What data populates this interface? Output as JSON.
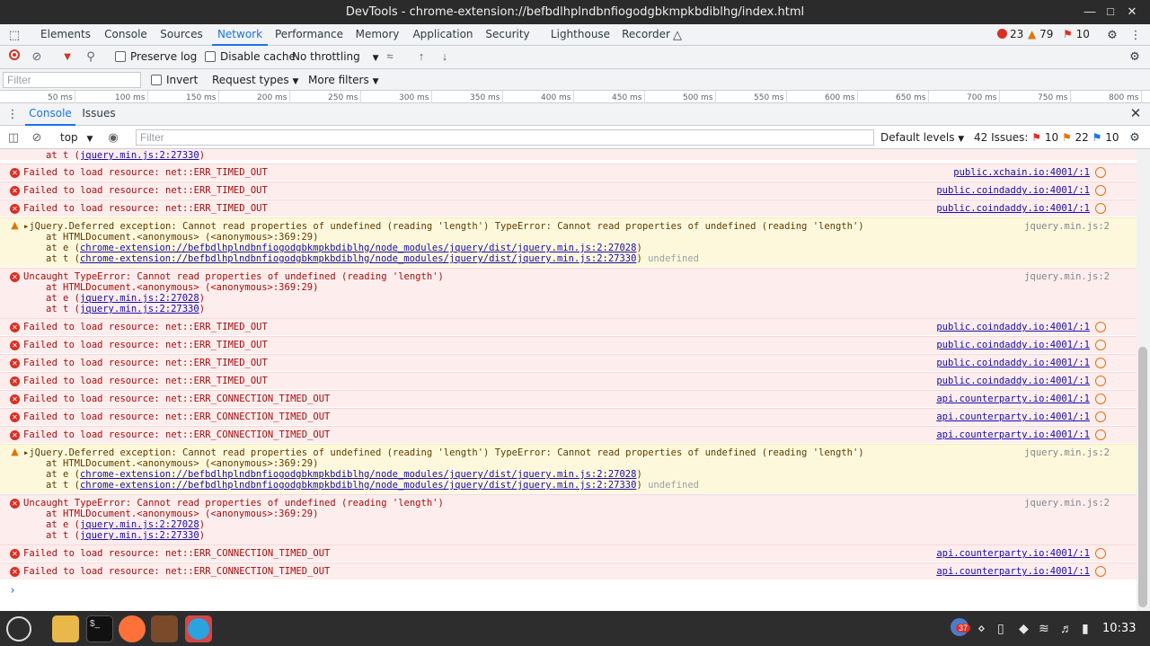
{
  "window": {
    "title": "DevTools - chrome-extension://befbdlhplndbnfiogodgbkmpkbdiblhg/index.html"
  },
  "tabs": [
    "Elements",
    "Console",
    "Sources",
    "Network",
    "Performance",
    "Memory",
    "Application",
    "Security",
    "Lighthouse",
    "Recorder"
  ],
  "counts": {
    "errors": "23",
    "warnings": "79",
    "issues": "10"
  },
  "network_toolbar": {
    "preserve_log": "Preserve log",
    "disable_cache": "Disable cache",
    "throttling": "No throttling"
  },
  "filter_row": {
    "placeholder": "Filter",
    "invert": "Invert",
    "request_types": "Request types",
    "more_filters": "More filters"
  },
  "ruler_ticks": [
    "50 ms",
    "100 ms",
    "150 ms",
    "200 ms",
    "250 ms",
    "300 ms",
    "350 ms",
    "400 ms",
    "450 ms",
    "500 ms",
    "550 ms",
    "600 ms",
    "650 ms",
    "700 ms",
    "750 ms",
    "800 ms"
  ],
  "drawer": {
    "console": "Console",
    "issues": "Issues"
  },
  "console_toolbar": {
    "context": "top",
    "filter_placeholder": "Filter",
    "levels": "Default levels",
    "issues_label": "42 Issues:",
    "issue_err": "10",
    "issue_warn": "22",
    "issue_info": "10"
  },
  "messages": {
    "first_stack": "at t (",
    "first_stack_link": "jquery.min.js:2:27330",
    "first_stack_end": ")",
    "timed_out": "Failed to load resource: net::ERR_TIMED_OUT",
    "conn_timed_out": "Failed to load resource: net::ERR_CONNECTION_TIMED_OUT",
    "src_xchain": "public.xchain.io:4001/:1",
    "src_coindaddy": "public.coindaddy.io:4001/:1",
    "src_counterparty": "api.counterparty.io:4001/:1",
    "deferred": "jQuery.Deferred exception: Cannot read properties of undefined (reading 'length') TypeError: Cannot read properties of undefined (reading 'length')",
    "deferred_src": "jquery.min.js:2",
    "stack_html": "at HTMLDocument.<anonymous> (<anonymous>:369:29)",
    "stack_e": "at e (",
    "stack_t": "at t (",
    "ext_e": "chrome-extension://befbdlhplndbnfiogodgbkmpkbdiblhg/node_modules/jquery/dist/jquery.min.js:2:27028",
    "ext_t": "chrome-extension://befbdlhplndbnfiogodgbkmpkbdiblhg/node_modules/jquery/dist/jquery.min.js:2:27330",
    "undefined": "undefined",
    "uncaught": "Uncaught TypeError: Cannot read properties of undefined (reading 'length')",
    "short_e": "jquery.min.js:2:27028",
    "short_t": "jquery.min.js:2:27330",
    "close_paren": ")"
  },
  "taskbar": {
    "badge": "37",
    "clock": "10:33"
  }
}
